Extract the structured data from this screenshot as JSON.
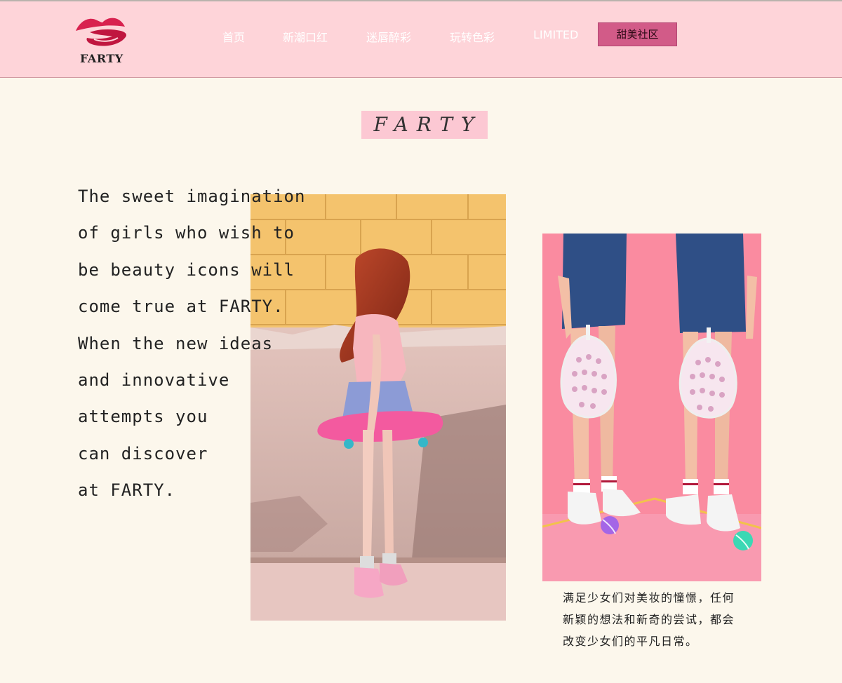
{
  "header": {
    "logo_text": "FARTY",
    "nav": [
      "首页",
      "新潮口红",
      "迷唇醉彩",
      "玩转色彩",
      "LIMITED"
    ],
    "cta_label": "甜美社区"
  },
  "main": {
    "brand_title": "FARTY",
    "english_lines": [
      "The sweet imagination",
      "of girls who wish to",
      "be beauty icons will",
      "come true at FARTY.",
      "When the new ideas",
      "and innovative",
      "attempts you",
      "can discover",
      "at FARTY."
    ],
    "chinese_lines": [
      "满足少女们对美妆的憧憬，任何",
      "新颖的想法和新奇的尝试，都会",
      "改变少女们的平凡日常。"
    ]
  },
  "colors": {
    "header_bg": "#fed4d9",
    "page_bg": "#fcf7ec",
    "accent": "#d25b88",
    "brand_bg": "#fcc8d3"
  },
  "icons": {
    "logo": "lips-logo-icon"
  }
}
